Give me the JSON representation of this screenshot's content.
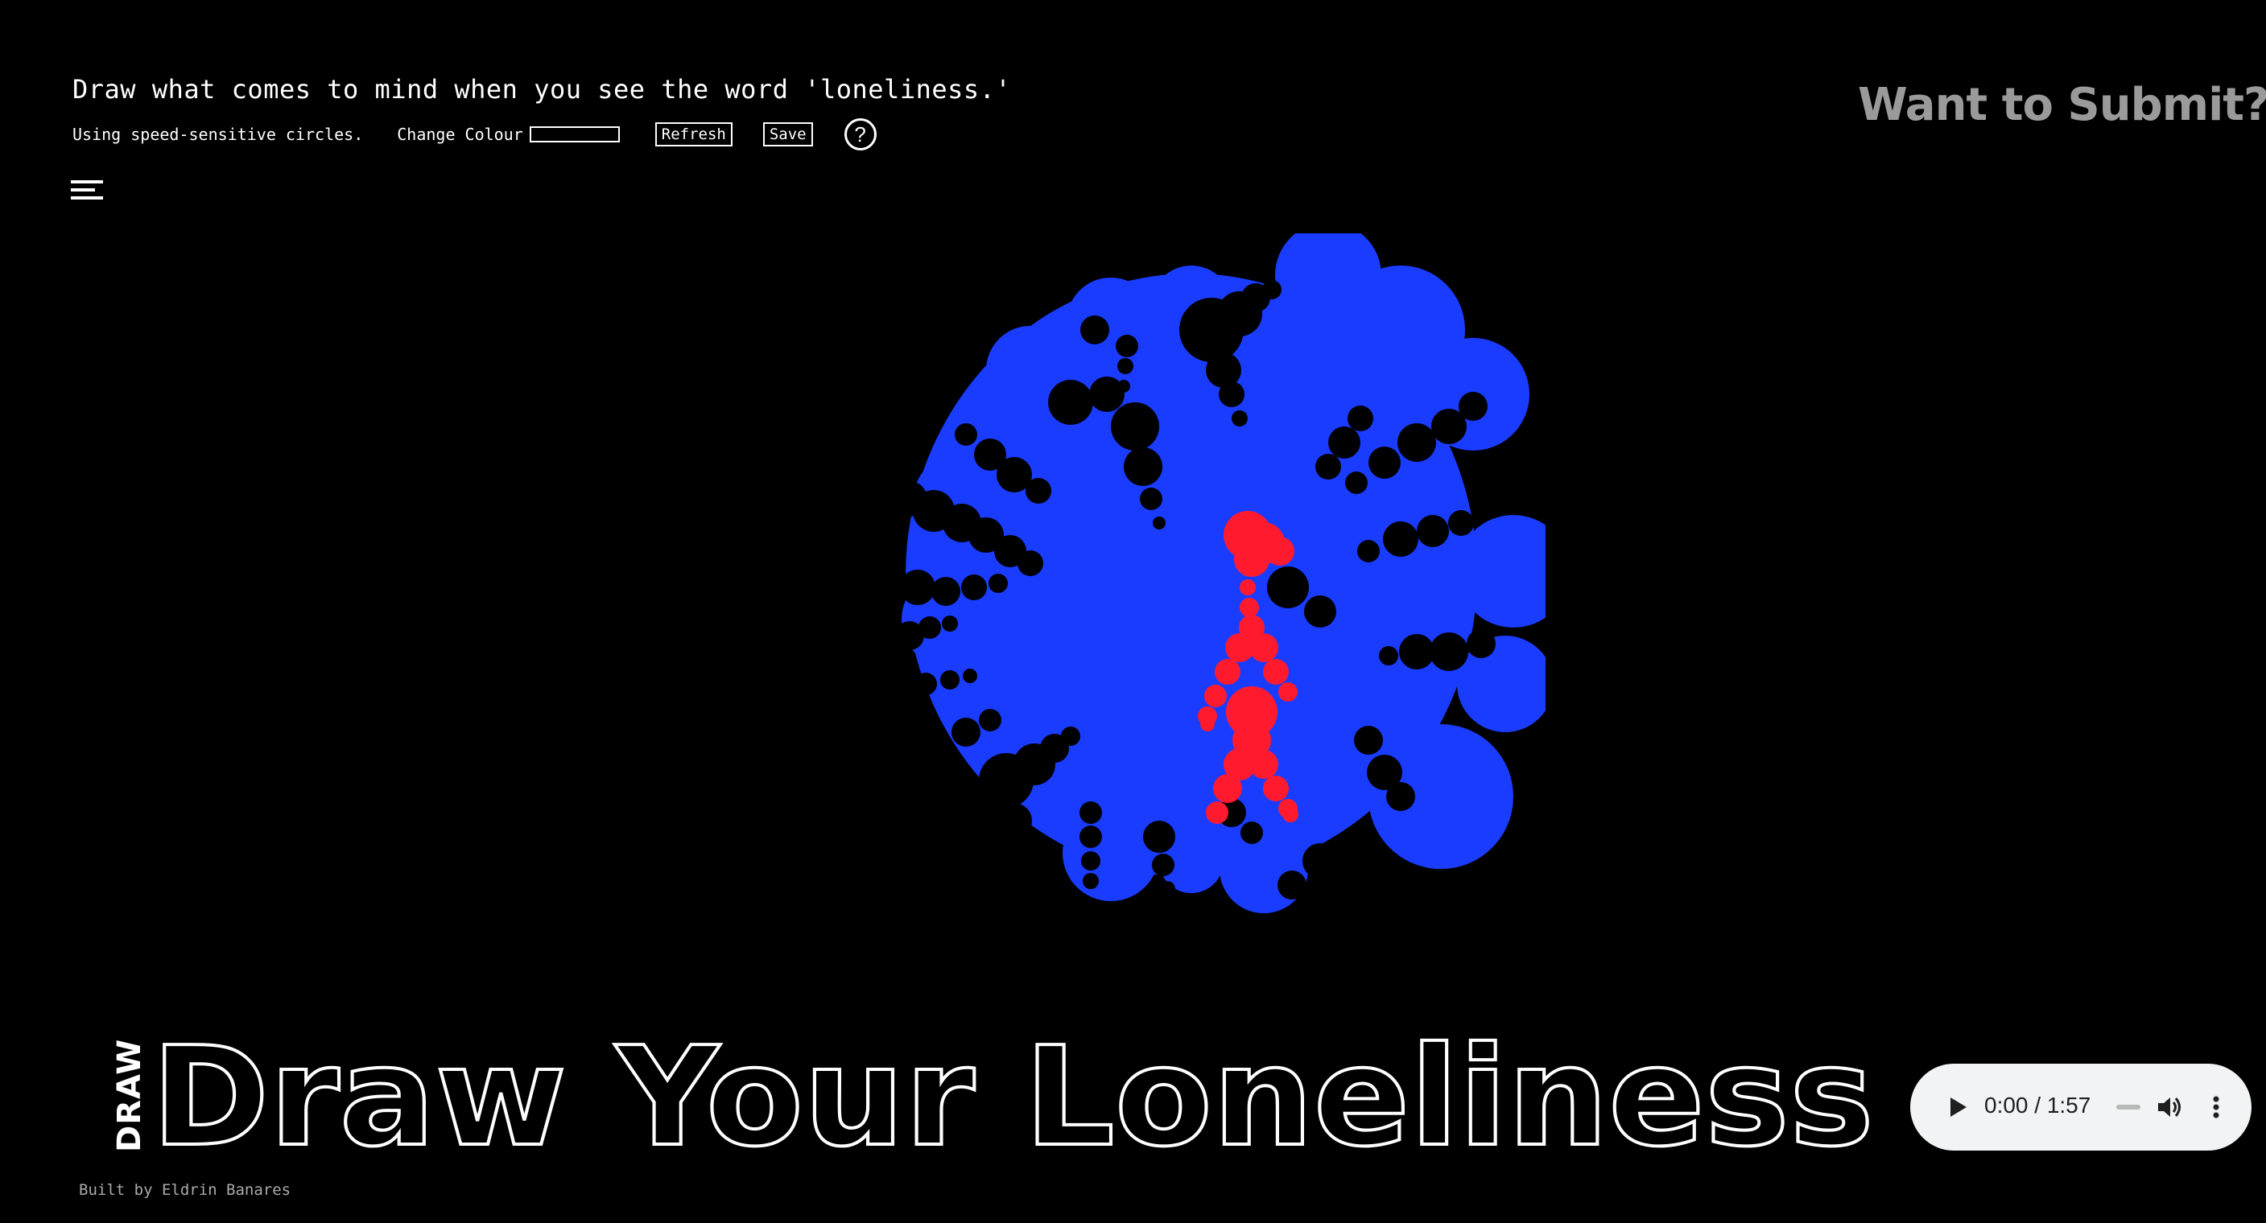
{
  "prompt": "Draw what comes to mind when you see the word 'loneliness.'",
  "toolbar": {
    "mode_text": "Using speed-sensitive circles.",
    "colour_label": "Change Colour",
    "refresh_label": "Refresh",
    "save_label": "Save",
    "help_symbol": "?"
  },
  "submit_link": "Want to Submit?",
  "side_label": "DRAW",
  "big_title": "Draw Your Loneliness",
  "audio": {
    "current_time": "0:00",
    "duration": "1:57",
    "time_display": "0:00 / 1:57"
  },
  "credit": "Built by Eldrin Banares",
  "colors": {
    "background": "#000000",
    "blob": "#1a3cff",
    "figure": "#ff1a2e",
    "submit_text": "#9a9a9a"
  },
  "icons": [
    "menu-icon",
    "help-icon",
    "play-icon",
    "volume-icon",
    "more-options-icon"
  ]
}
